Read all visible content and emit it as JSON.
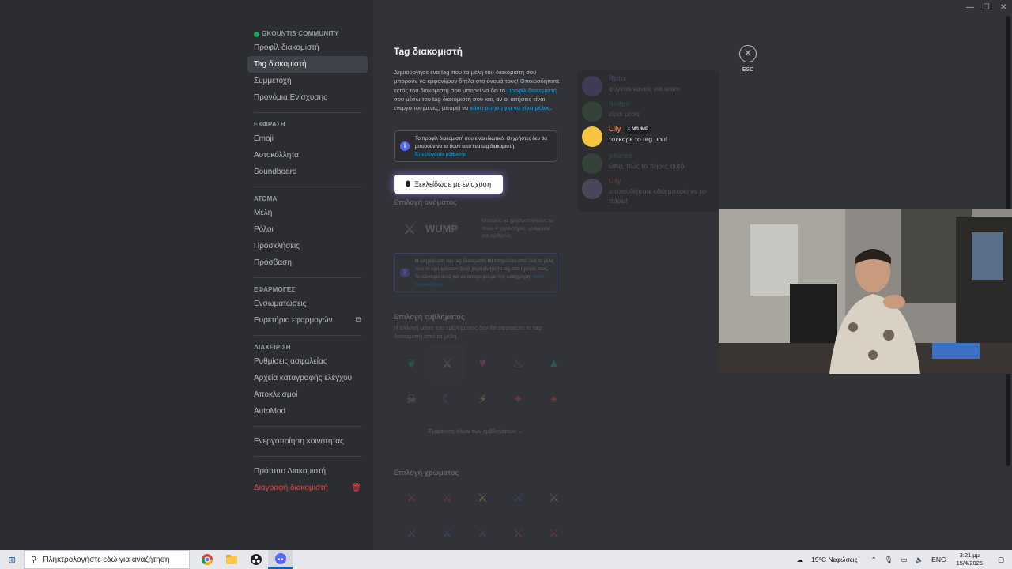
{
  "window_controls": {
    "minimize": "—",
    "maximize": "☐",
    "close": "✕"
  },
  "sidebar": {
    "server_name": "GKOUNTIS COMMUNITY",
    "server_items": [
      {
        "label": "Προφίλ διακομιστή",
        "active": false
      },
      {
        "label": "Tag διακομιστή",
        "active": true
      },
      {
        "label": "Συμμετοχή",
        "active": false
      },
      {
        "label": "Προνόμια Ενίσχυσης",
        "active": false
      }
    ],
    "expression_header": "ΕΚΦΡΑΣΗ",
    "expression_items": [
      "Emoji",
      "Αυτοκόλλητα",
      "Soundboard"
    ],
    "people_header": "ΑΤΟΜΑ",
    "people_items": [
      "Μέλη",
      "Ρόλοι",
      "Προσκλήσεις",
      "Πρόσβαση"
    ],
    "apps_header": "ΕΦΑΡΜΟΓΕΣ",
    "apps_items": [
      "Ενσωματώσεις",
      "Ευρετήριο εφαρμογών"
    ],
    "admin_header": "ΔΙΑΧΕΙΡΙΣΗ",
    "admin_items": [
      "Ρυθμίσεις ασφαλείας",
      "Αρχεία καταγραφής ελέγχου",
      "Αποκλεισμοί",
      "AutoMod"
    ],
    "community_item": "Ενεργοποίηση κοινότητας",
    "template_item": "Πρότυπο Διακομιστή",
    "delete_item": "Διαγραφή διακομιστή"
  },
  "main": {
    "title": "Tag διακομιστή",
    "desc_part1": "Δημιούργησε ένα tag που τα μέλη του διακομιστή σου μπορούν να εμφανίζουν δίπλα στο όνομά τους! Οποιοσδήποτε εκτός του διακομιστή σου μπορεί να δει το ",
    "desc_link1": "Προφίλ διακομιστή",
    "desc_part2": " σου μέσω του tag διακομιστή σου και, αν οι αιτήσεις είναι ενεργοποιημένες, μπορεί να ",
    "desc_link2": "κάνει αίτηση για να γίνει μέλος",
    "desc_part3": ".",
    "info_text": "Το προφίλ διακομιστή σου είναι ιδιωτικό. Οι χρήστες δεν θα μπορούν να το δουν από ένα tag διακομιστή.",
    "info_link": "Επεξεργασία ρύθμισης",
    "unlock_button": "Ξεκλείδωσε με ενίσχυση",
    "name_section": "Επιλογή ονόματος",
    "tag_name": "WUMP",
    "name_hint": "Μπορείς να χρησιμοποιήσεις το πολύ 4 χαρακτήρες, γράμματα και αριθμούς.",
    "notice_text": "Η ενημέρωση του tag διακομιστή θα επηρεάσει από όλα τα μέλη που το εφαρμόσουν ξανά χειροκίνητα το tag στο προφίλ τους. Το κάνουμε αυτό για να αποτρέψουμε την κατάχρηση.",
    "notice_link": "Μάθε περισσότερα",
    "badge_section": "Επιλογή εμβλήματος",
    "badge_desc": "Η αλλαγή μόνο του εμβλήματος δεν θα αφαιρέσει το tag διακομιστή από τα μέλη.",
    "badges": [
      {
        "icon": "leaf-icon",
        "glyph": "❦",
        "color": "#3ba55c"
      },
      {
        "icon": "sword-icon",
        "glyph": "⚔",
        "color": "#b5bac1"
      },
      {
        "icon": "heart-icon",
        "glyph": "♥",
        "color": "#eb459e"
      },
      {
        "icon": "flame-icon",
        "glyph": "♨",
        "color": "#f57731"
      },
      {
        "icon": "droplet-icon",
        "glyph": "▲",
        "color": "#1abc9c"
      },
      {
        "icon": "skull-icon",
        "glyph": "☠",
        "color": "#dbdee1"
      },
      {
        "icon": "moon-icon",
        "glyph": "☾",
        "color": "#9b59b6"
      },
      {
        "icon": "lightning-icon",
        "glyph": "⚡",
        "color": "#fee75c"
      },
      {
        "icon": "gem-icon",
        "glyph": "✦",
        "color": "#eb459e"
      },
      {
        "icon": "mushroom-icon",
        "glyph": "♠",
        "color": "#ed4245"
      }
    ],
    "show_all": "Εμφάνιση όλων των εμβλημάτων ⌄",
    "color_section": "Επιλογή χρώματος",
    "color_swatches": [
      "#eb459e",
      "#ed4245",
      "#fee75c",
      "#5865f2",
      "#b5bac1",
      "#9b59b6",
      "#5865f2",
      "#9b59b6",
      "#eb459e",
      "#ed4245"
    ]
  },
  "chat_preview": [
    {
      "name": "Robx",
      "text": "φύγεται κανείς για aram",
      "name_color": "#c27cff",
      "avatar": "#8e6fd8",
      "dim": true
    },
    {
      "name": "huego",
      "text": "είμαι μέσα",
      "name_color": "#3ba55c",
      "avatar": "#5a8e5a",
      "dim": true
    },
    {
      "name": "Lily",
      "text": "τσέκαρε το tag μου!",
      "name_color": "#f57731",
      "avatar": "#f5c542",
      "dim": false,
      "tag": "WUMP"
    },
    {
      "name": "pharos",
      "text": "ώπα, πώς το πήρες αυτό",
      "name_color": "#3ba55c",
      "avatar": "#5a8e5a",
      "dim": true
    },
    {
      "name": "Lily",
      "text": "οποιοσδήποτε εδώ μπορεί να το πάρει!",
      "name_color": "#f57731",
      "avatar": "#b5a0f0",
      "dim": true
    }
  ],
  "esc": {
    "icon": "✕",
    "label": "ESC"
  },
  "taskbar": {
    "search_placeholder": "Πληκτρολογήστε εδώ για αναζήτηση",
    "weather": "19°C  Νεφώσεις",
    "lang": "ENG",
    "time": "3:21 μμ",
    "date": "15/4/2026"
  }
}
